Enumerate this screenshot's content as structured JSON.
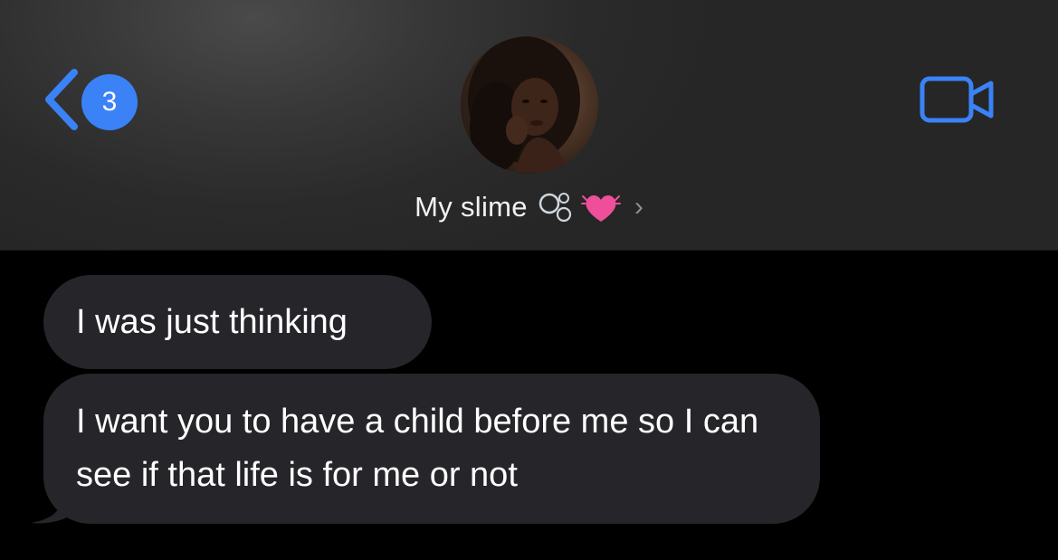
{
  "header": {
    "back_badge_count": "3",
    "contact_name": "My slime",
    "contact_emojis": "bubbles, beating-heart",
    "avatar": "contact-photo"
  },
  "icons": {
    "back": "chevron-left-icon",
    "video": "video-camera-icon",
    "disclosure": "chevron-right-icon"
  },
  "messages": [
    {
      "direction": "incoming",
      "text": "I was just thinking"
    },
    {
      "direction": "incoming",
      "text": "I want you to have a child before me so I can see if that life is for me or not"
    }
  ],
  "colors": {
    "accent": "#3b82f6",
    "incoming_bubble": "#26252a",
    "background": "#000000",
    "header": "#2f2f2f"
  }
}
